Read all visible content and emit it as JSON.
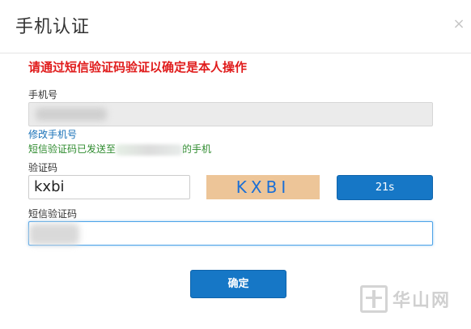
{
  "dialog": {
    "title": "手机认证",
    "close_glyph": "×",
    "warning": "请通过短信验证码验证以确定是本人操作"
  },
  "phone": {
    "label": "手机号",
    "value": "",
    "change_link": "修改手机号",
    "sent_prefix": "短信验证码已发送至",
    "sent_suffix": "的手机"
  },
  "captcha": {
    "label": "验证码",
    "value": "kxbi",
    "image_text": "KXBI",
    "countdown_label": "21s"
  },
  "sms": {
    "label": "短信验证码",
    "value": ""
  },
  "actions": {
    "confirm_label": "确定"
  },
  "watermark": {
    "text": "华山网"
  },
  "colors": {
    "warning": "#e01b1b",
    "link": "#1a72b8",
    "sent": "#2e8b2e",
    "button": "#1677c6",
    "captcha_bg": "#edc598",
    "captcha_text": "#1a6fd6"
  }
}
